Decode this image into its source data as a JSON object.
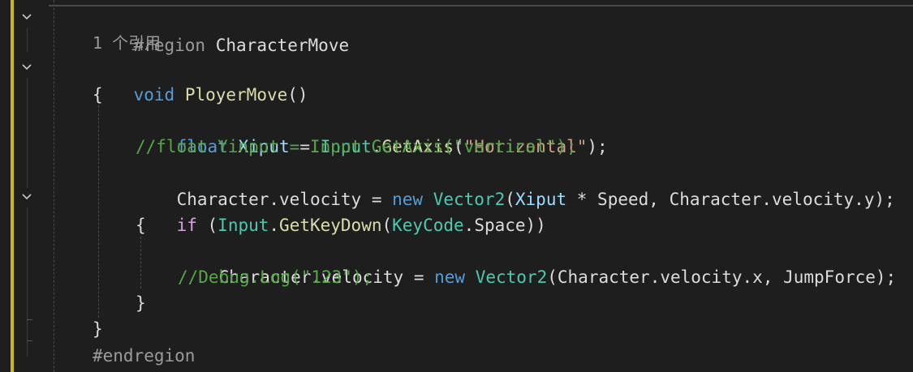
{
  "editor": {
    "code_lens": "1 个引用",
    "lines": {
      "region": [
        "#region",
        " ",
        "CharacterMove"
      ],
      "method": [
        "void",
        " ",
        "PloyerMove",
        "()"
      ],
      "open1": "{",
      "l_float": [
        "float",
        " ",
        "Xiput",
        " = ",
        "Input",
        ".",
        "GetAxis",
        "(",
        "\"Horizontal\"",
        ");"
      ],
      "l_comment1": "//float Yinput = Input.GetAxis(\"vertical\");",
      "l_vel1": [
        "Character",
        ".",
        "velocity",
        " = ",
        "new",
        " ",
        "Vector2",
        "(",
        "Xiput",
        " * ",
        "Speed",
        ", ",
        "Character",
        ".",
        "velocity",
        ".",
        "y",
        ");"
      ],
      "l_if": [
        "if",
        " (",
        "Input",
        ".",
        "GetKeyDown",
        "(",
        "KeyCode",
        ".",
        "Space",
        "))"
      ],
      "open2": "{",
      "l_vel2": [
        "Character",
        ".",
        "velocity",
        " = ",
        "new",
        " ",
        "Vector2",
        "(",
        "Character",
        ".",
        "velocity",
        ".",
        "x",
        ", ",
        "JumpForce",
        ");"
      ],
      "l_comment2": "//Debug.Log(\"123\");",
      "close2": "}",
      "close1": "}",
      "endregion": "#endregion"
    }
  },
  "gutter": {
    "fold_icons": [
      "chevron-down-icon",
      "chevron-down-icon",
      "chevron-down-icon"
    ]
  },
  "colors": {
    "background": "#1e1e1e",
    "keyword": "#569cd6",
    "control_keyword": "#d8a0df",
    "type": "#4ec9b0",
    "method": "#dcdcaa",
    "string": "#d69d85",
    "comment": "#57a64a",
    "preprocessor": "#9b9b9b",
    "modified_marker": "#c9b71b"
  }
}
